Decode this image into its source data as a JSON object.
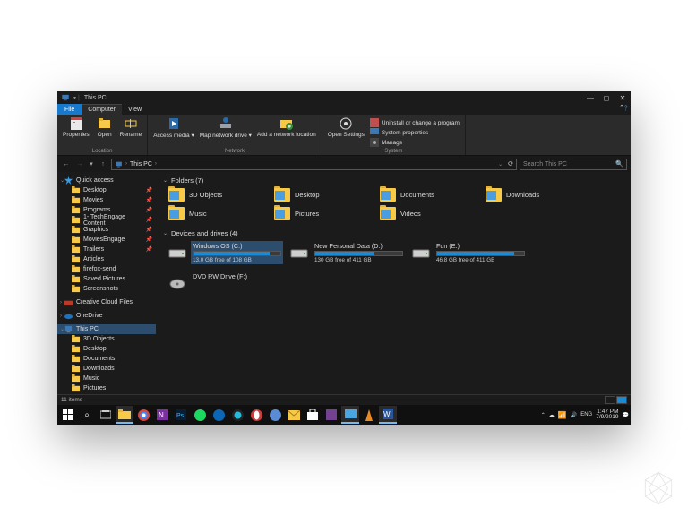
{
  "window": {
    "title": "This PC"
  },
  "tabs": {
    "file": "File",
    "computer": "Computer",
    "view": "View"
  },
  "ribbon": {
    "location": {
      "label": "Location",
      "properties": "Properties",
      "open": "Open",
      "rename": "Rename"
    },
    "network": {
      "label": "Network",
      "access_media": "Access media ▾",
      "map_drive": "Map network drive ▾",
      "add_location": "Add a network location"
    },
    "settings": {
      "label": "System",
      "open_settings": "Open Settings",
      "uninstall": "Uninstall or change a program",
      "sys_props": "System properties",
      "manage": "Manage"
    }
  },
  "address": {
    "location": "This PC",
    "search_placeholder": "Search This PC"
  },
  "sidebar": {
    "quick_access": "Quick access",
    "items": [
      {
        "label": "Desktop",
        "pin": true
      },
      {
        "label": "Movies",
        "pin": true
      },
      {
        "label": "Programs",
        "pin": true
      },
      {
        "label": "1- TechEngage Content",
        "pin": true
      },
      {
        "label": "Graphics",
        "pin": true
      },
      {
        "label": "MoviesEngage",
        "pin": true
      },
      {
        "label": "Trailers",
        "pin": true
      },
      {
        "label": "Articles"
      },
      {
        "label": "firefox-send"
      },
      {
        "label": "Saved Pictures"
      },
      {
        "label": "Screenshots"
      }
    ],
    "ccf": "Creative Cloud Files",
    "onedrive": "OneDrive",
    "thispc": "This PC",
    "pc_children": [
      "3D Objects",
      "Desktop",
      "Documents",
      "Downloads",
      "Music",
      "Pictures"
    ]
  },
  "folders_header": "Folders (7)",
  "folders": [
    "3D Objects",
    "Desktop",
    "Documents",
    "Downloads",
    "Music",
    "Pictures",
    "Videos"
  ],
  "drives_header": "Devices and drives (4)",
  "drives": [
    {
      "name": "Windows OS (C:)",
      "free": "13.0 GB free of 108 GB",
      "pct": 88
    },
    {
      "name": "New Personal Data (D:)",
      "free": "130 GB free of 411 GB",
      "pct": 68
    },
    {
      "name": "Fun (E:)",
      "free": "46.8 GB free of 411 GB",
      "pct": 89
    },
    {
      "name": "DVD RW Drive (F:)",
      "free": "",
      "pct": null
    }
  ],
  "status": {
    "count": "11 items"
  },
  "tray": {
    "time": "1:47 PM",
    "date": "7/9/2019"
  }
}
